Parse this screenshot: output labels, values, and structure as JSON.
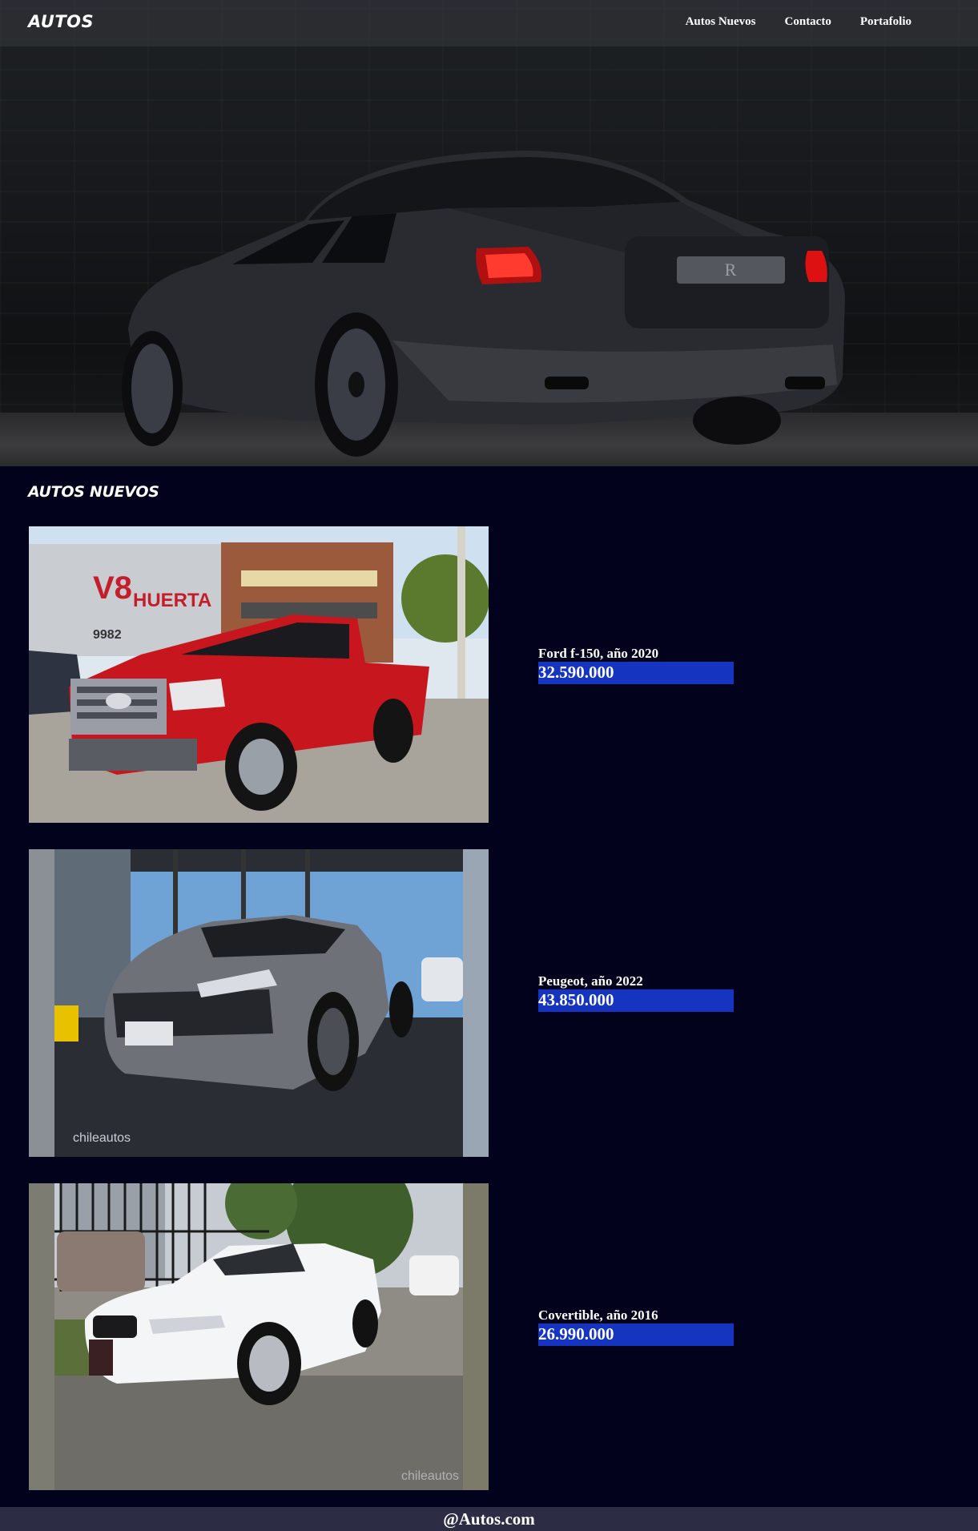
{
  "navbar": {
    "brand": "AUTOS",
    "links": [
      {
        "label": "Autos Nuevos"
      },
      {
        "label": "Contacto"
      },
      {
        "label": "Portafolio"
      }
    ]
  },
  "section": {
    "title": "AUTOS NUEVOS"
  },
  "cars": [
    {
      "name": "Ford f-150, año 2020",
      "price": "32.590.000"
    },
    {
      "name": "Peugeot, año 2022",
      "price": "43.850.000"
    },
    {
      "name": "Covertible, año 2016",
      "price": "26.990.000"
    }
  ],
  "footer": {
    "text": "@Autos.com"
  },
  "colors": {
    "background": "#02021c",
    "price_highlight": "#1535c0",
    "footer": "#2c2c44"
  }
}
